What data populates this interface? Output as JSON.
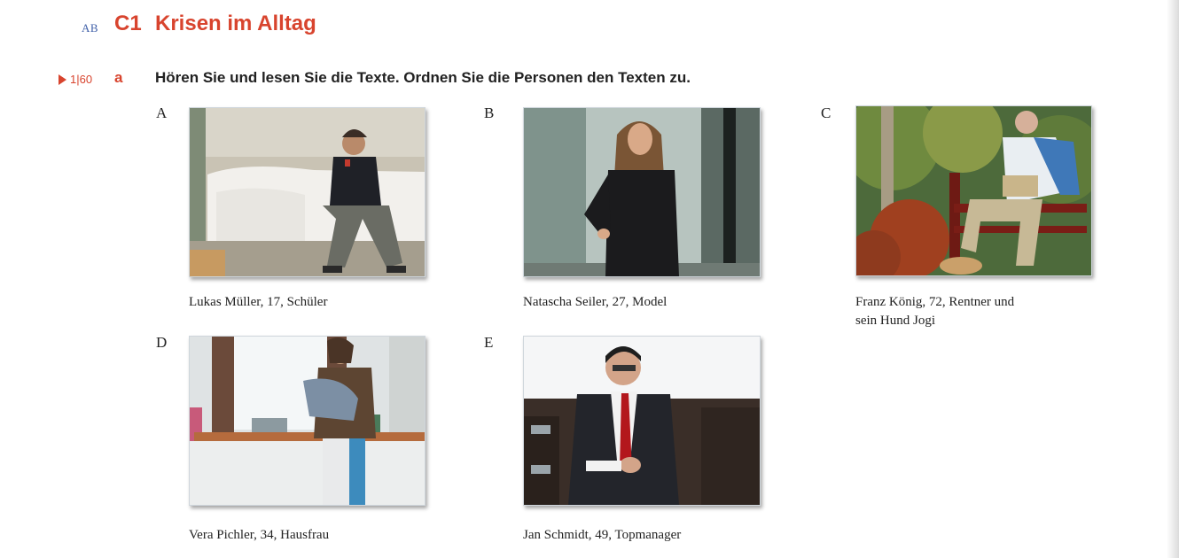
{
  "header": {
    "ab_tag": "AB",
    "section_code": "C1",
    "section_title": "Krisen im Alltag"
  },
  "exercise": {
    "track_label": "1|60",
    "task_letter": "a",
    "instruction": "Hören Sie und lesen Sie die Texte. Ordnen Sie die Personen den Texten zu."
  },
  "photos": [
    {
      "letter": "A",
      "caption_lines": [
        "Lukas Müller, 17, Schüler"
      ]
    },
    {
      "letter": "B",
      "caption_lines": [
        "Natascha Seiler, 27, Model"
      ]
    },
    {
      "letter": "C",
      "caption_lines": [
        "Franz König, 72, Rentner und",
        "sein Hund Jogi"
      ]
    },
    {
      "letter": "D",
      "caption_lines": [
        "Vera Pichler, 34, Hausfrau"
      ]
    },
    {
      "letter": "E",
      "caption_lines": [
        "Jan Schmidt, 49, Topmanager"
      ]
    }
  ],
  "colors": {
    "accent": "#d8442e",
    "ab_blue": "#3f5fa8"
  }
}
